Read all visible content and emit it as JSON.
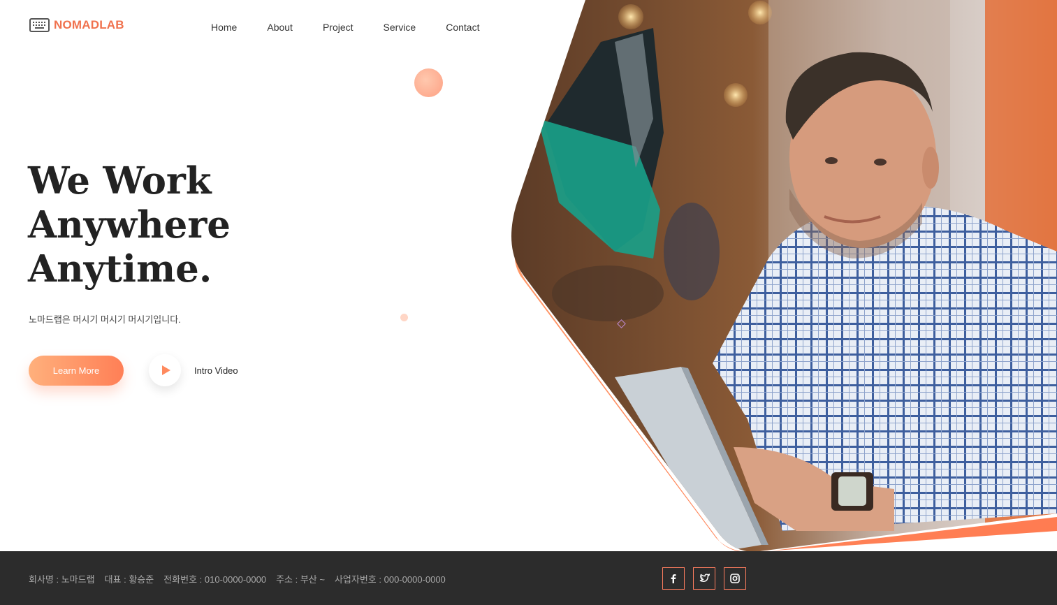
{
  "brand": {
    "name": "NOMADLAB",
    "logo_icon": "keyboard-icon",
    "color": "#f0724e"
  },
  "nav": {
    "items": [
      "Home",
      "About",
      "Project",
      "Service",
      "Contact"
    ]
  },
  "hero": {
    "headline": [
      "We Work",
      "Anywhere",
      "Anytime."
    ],
    "tagline": "노마드랩은 머시기 머시기 머시기입니다.",
    "cta_label": "Learn More",
    "video_label": "Intro Video",
    "video_icon": "play-icon",
    "accent_gradient": [
      "#ffb07c",
      "#ff7f56"
    ]
  },
  "footer": {
    "company": "회사명 : 노마드랩",
    "ceo": "대표 : 황승준",
    "phone": "전화번호 : 010-0000-0000",
    "address": "주소 : 부산 ~",
    "business_no": "사업자번호 : 000-0000-0000",
    "socials": [
      "facebook-icon",
      "twitter-icon",
      "instagram-icon"
    ],
    "background": "#2c2c2c"
  }
}
